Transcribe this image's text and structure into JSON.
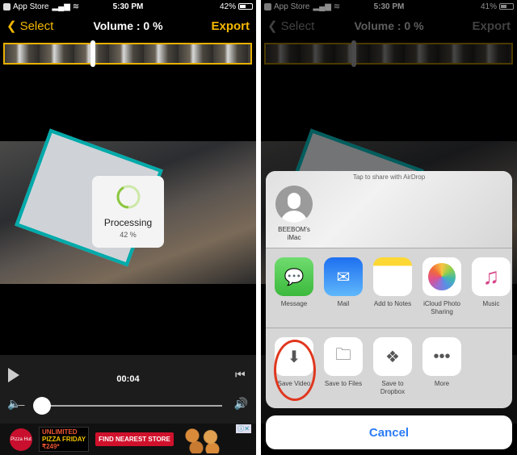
{
  "left": {
    "status": {
      "carrier": "App Store",
      "time": "5:30 PM",
      "battery": "42%",
      "battery_level": 0.42
    },
    "nav": {
      "select": "Select",
      "title": "Volume : 0 %",
      "export": "Export"
    },
    "processing": {
      "label": "Processing",
      "percent": "42 %",
      "progress": 0.42
    },
    "player": {
      "time": "00:04",
      "volume": 0
    },
    "ad": {
      "logo": "Pizza Hut",
      "line1": "UNLIMITED",
      "line2": "PIZZA FRIDAY",
      "price": "₹249*",
      "cta": "FIND NEAREST STORE"
    }
  },
  "right": {
    "status": {
      "carrier": "App Store",
      "time": "5:30 PM",
      "battery": "41%",
      "battery_level": 0.41
    },
    "nav": {
      "select": "Select",
      "title": "Volume : 0 %",
      "export": "Export"
    },
    "share": {
      "airdrop_hint": "Tap to share with AirDrop",
      "device": "BEEBOM's iMac",
      "apps": [
        {
          "label": "Message",
          "icon": "messages-icon"
        },
        {
          "label": "Mail",
          "icon": "mail-icon"
        },
        {
          "label": "Add to Notes",
          "icon": "notes-icon"
        },
        {
          "label": "iCloud Photo Sharing",
          "icon": "photos-icon"
        },
        {
          "label": "Music",
          "icon": "music-icon"
        }
      ],
      "actions": [
        {
          "label": "Save Video",
          "icon": "save-video-icon"
        },
        {
          "label": "Save to Files",
          "icon": "folder-icon"
        },
        {
          "label": "Save to Dropbox",
          "icon": "dropbox-icon"
        },
        {
          "label": "More",
          "icon": "more-icon"
        }
      ],
      "cancel": "Cancel"
    }
  },
  "colors": {
    "accent": "#f5b800",
    "progress": "#8cc63f",
    "cancel": "#2b7cf5",
    "highlight": "#e0371f"
  }
}
